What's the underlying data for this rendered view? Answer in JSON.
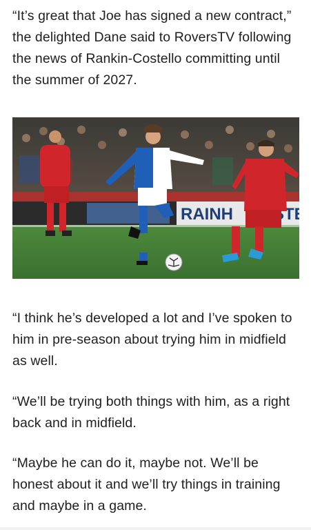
{
  "article": {
    "paragraphs": [
      "“It’s great that Joe has signed a new contract,” the delighted Dane said to RoversTV following the news of Rankin-Costello committing until the summer of 2027.",
      "“I think he’s developed a lot and I’ve spoken to him in pre-season about trying him in midfield as well.",
      "“We’ll be trying both things with him, as a right back and in midfield.",
      "“Maybe he can do it, maybe not. We’ll be honest about it and we’ll try things in training and maybe in a game."
    ],
    "photo": {
      "board_text_left": "RAINH",
      "board_text_right": "STEE",
      "colors": {
        "pitch": "#3f7a34",
        "home_kit_blue": "#1f5fb8",
        "away_kit_red": "#d0262b"
      }
    }
  }
}
